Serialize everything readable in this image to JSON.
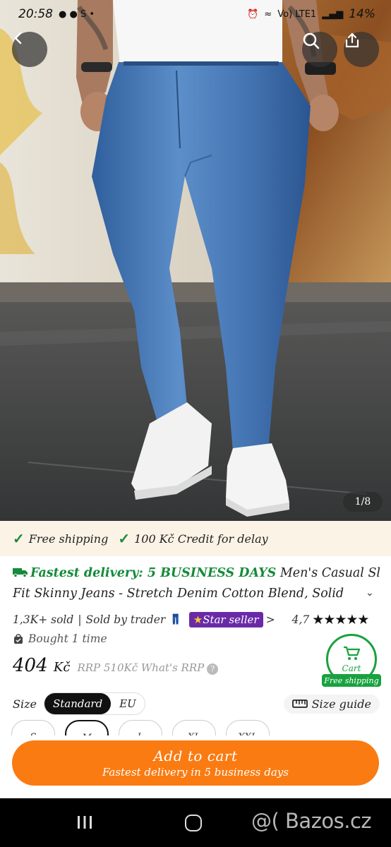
{
  "status_bar": {
    "time": "20:58",
    "battery": "14%",
    "network": "Vo) LTE1"
  },
  "gallery": {
    "counter": "1/8",
    "icons": [
      "back-arrow-icon",
      "search-icon",
      "share-icon"
    ]
  },
  "benefits": [
    {
      "label": "Free shipping"
    },
    {
      "label": "100 Kč Credit for delay"
    }
  ],
  "product": {
    "fast_delivery": "Fastest delivery: 5 BUSINESS DAYS",
    "title_part1": "Men's Casual Slim",
    "title_line2": "Fit Skinny Jeans - Stretch Denim Cotton Blend, Solid"
  },
  "meta": {
    "sold": "1,3K+ sold",
    "separator": "|",
    "sold_by": "Sold by trader",
    "star_seller": "Star seller",
    "rating": "4,7"
  },
  "bought": "Bought 1 time",
  "price": {
    "value": "404",
    "currency": "Kč",
    "rrp": "RRP 510Kč What's RRP"
  },
  "cart_badge": {
    "label": "Cart",
    "tag": "Free shipping"
  },
  "size": {
    "label": "Size",
    "options_tabs": [
      "Standard",
      "EU"
    ],
    "guide": "Size guide",
    "sizes": [
      "S",
      "M",
      "L",
      "XL",
      "XXL"
    ]
  },
  "add_to_cart": {
    "main": "Add to cart",
    "sub": "Fastest delivery in 5 business days"
  },
  "watermark": "@( Bazos.cz",
  "colors": {
    "accent_orange": "#fa7b12",
    "green": "#18a23f",
    "star_seller": "#6a2aa8",
    "benefits_bg": "#fbf3e6"
  }
}
